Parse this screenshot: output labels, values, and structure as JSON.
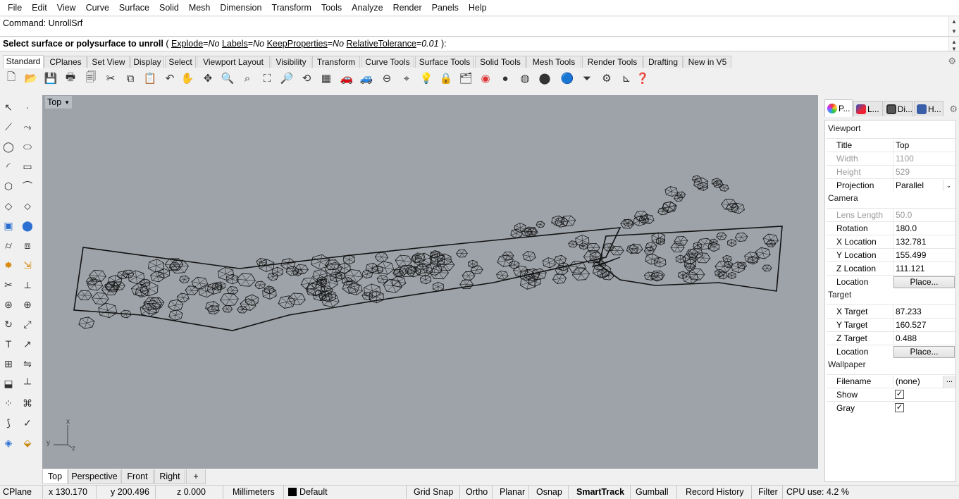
{
  "menu": [
    "File",
    "Edit",
    "View",
    "Curve",
    "Surface",
    "Solid",
    "Mesh",
    "Dimension",
    "Transform",
    "Tools",
    "Analyze",
    "Render",
    "Panels",
    "Help"
  ],
  "command": {
    "history": "Command: UnrollSrf",
    "prompt_main": "Select surface or polysurface to unroll",
    "options": [
      {
        "name": "Explode",
        "value": "No"
      },
      {
        "name": "Labels",
        "value": "No"
      },
      {
        "name": "KeepProperties",
        "value": "No"
      },
      {
        "name": "RelativeTolerance",
        "value": "0.01"
      }
    ],
    "open_paren": " ( ",
    "close": " ):"
  },
  "toolbar_tabs": [
    "Standard",
    "CPlanes",
    "Set View",
    "Display",
    "Select",
    "Viewport Layout",
    "Visibility",
    "Transform",
    "Curve Tools",
    "Surface Tools",
    "Solid Tools",
    "Mesh Tools",
    "Render Tools",
    "Drafting",
    "New in V5"
  ],
  "toolbar_icons": [
    "new-icon",
    "open-icon",
    "save-icon",
    "print-icon",
    "export-icon",
    "cut-icon",
    "copy-icon",
    "paste-icon",
    "undo-icon",
    "pan-icon",
    "rotate-view-icon",
    "zoom-dynamic-icon",
    "zoom-window-icon",
    "zoom-extents-icon",
    "zoom-selected-icon",
    "undo-view-icon",
    "four-viewports-icon",
    "car-icon",
    "car-wire-icon",
    "cplane-icon",
    "snap-icon",
    "light-icon",
    "lock-icon",
    "layer-icon",
    "color-wheel-icon",
    "render-shaded-icon",
    "render-preview-icon",
    "render-icon",
    "sphere-icon",
    "select-filter-icon",
    "gear-icon",
    "dimension-icon",
    "help-icon"
  ],
  "left_icons": [
    "select-arrow-icon",
    "point-icon",
    "polyline-icon",
    "curve-points-icon",
    "circle-icon",
    "ellipse-icon",
    "arc-icon",
    "rectangle-icon",
    "polygon-icon",
    "fillet-icon",
    "surface-corner-icon",
    "surface-edge-icon",
    "box-icon",
    "sphere-solid-icon",
    "cylinder-icon",
    "mesh-plane-icon",
    "explode-icon",
    "extend-icon",
    "trim-icon",
    "split-icon",
    "boolean-icon",
    "join-icon",
    "rotate-icon",
    "scale-icon",
    "text-icon",
    "dimension-left-icon",
    "array-icon",
    "mirror-icon",
    "project-icon",
    "measure-icon",
    "grid-array-icon",
    "history-icon",
    "bend-icon",
    "check-icon",
    "solid-edit-icon",
    "paint-bucket-icon"
  ],
  "viewport": {
    "name": "Top",
    "axis_x": "x",
    "axis_y": "y",
    "axis_z": "z"
  },
  "view_tabs": [
    "Top",
    "Perspective",
    "Front",
    "Right",
    "+"
  ],
  "panel": {
    "tabs": [
      "P...",
      "L...",
      "Di...",
      "H..."
    ],
    "sections": {
      "viewport": "Viewport",
      "camera": "Camera",
      "target": "Target",
      "wallpaper": "Wallpaper"
    },
    "viewport_props": [
      {
        "label": "Title",
        "value": "Top",
        "disabled": false
      },
      {
        "label": "Width",
        "value": "1100",
        "disabled": true
      },
      {
        "label": "Height",
        "value": "529",
        "disabled": true
      },
      {
        "label": "Projection",
        "value": "Parallel",
        "disabled": false
      }
    ],
    "camera_props": [
      {
        "label": "Lens Length",
        "value": "50.0",
        "disabled": true
      },
      {
        "label": "Rotation",
        "value": "180.0",
        "disabled": false
      },
      {
        "label": "X Location",
        "value": "132.781",
        "disabled": false
      },
      {
        "label": "Y Location",
        "value": "155.499",
        "disabled": false
      },
      {
        "label": "Z Location",
        "value": "111.121",
        "disabled": false
      },
      {
        "label": "Location",
        "value": "Place...",
        "disabled": false
      }
    ],
    "target_props": [
      {
        "label": "X Target",
        "value": "87.233",
        "disabled": false
      },
      {
        "label": "Y Target",
        "value": "160.527",
        "disabled": false
      },
      {
        "label": "Z Target",
        "value": "0.488",
        "disabled": false
      },
      {
        "label": "Location",
        "value": "Place...",
        "disabled": false
      }
    ],
    "wallpaper_props": [
      {
        "label": "Filename",
        "value": "(none)",
        "button": "..."
      },
      {
        "label": "Show",
        "checked": true
      },
      {
        "label": "Gray",
        "checked": true
      }
    ]
  },
  "status": {
    "cplane": "CPlane",
    "x": "x 130.170",
    "y": "y 200.496",
    "z": "z 0.000",
    "units": "Millimeters",
    "layer": "Default",
    "grid_snap": "Grid Snap",
    "ortho": "Ortho",
    "planar": "Planar",
    "osnap": "Osnap",
    "smarttrack": "SmartTrack",
    "gumball": "Gumball",
    "record_history": "Record History",
    "filter": "Filter",
    "cpu": "CPU use: 4.2 %"
  },
  "colors": {
    "viewport_bg": "#9ea3a9",
    "wire": "#111111",
    "layer_swatch": "#000000"
  }
}
